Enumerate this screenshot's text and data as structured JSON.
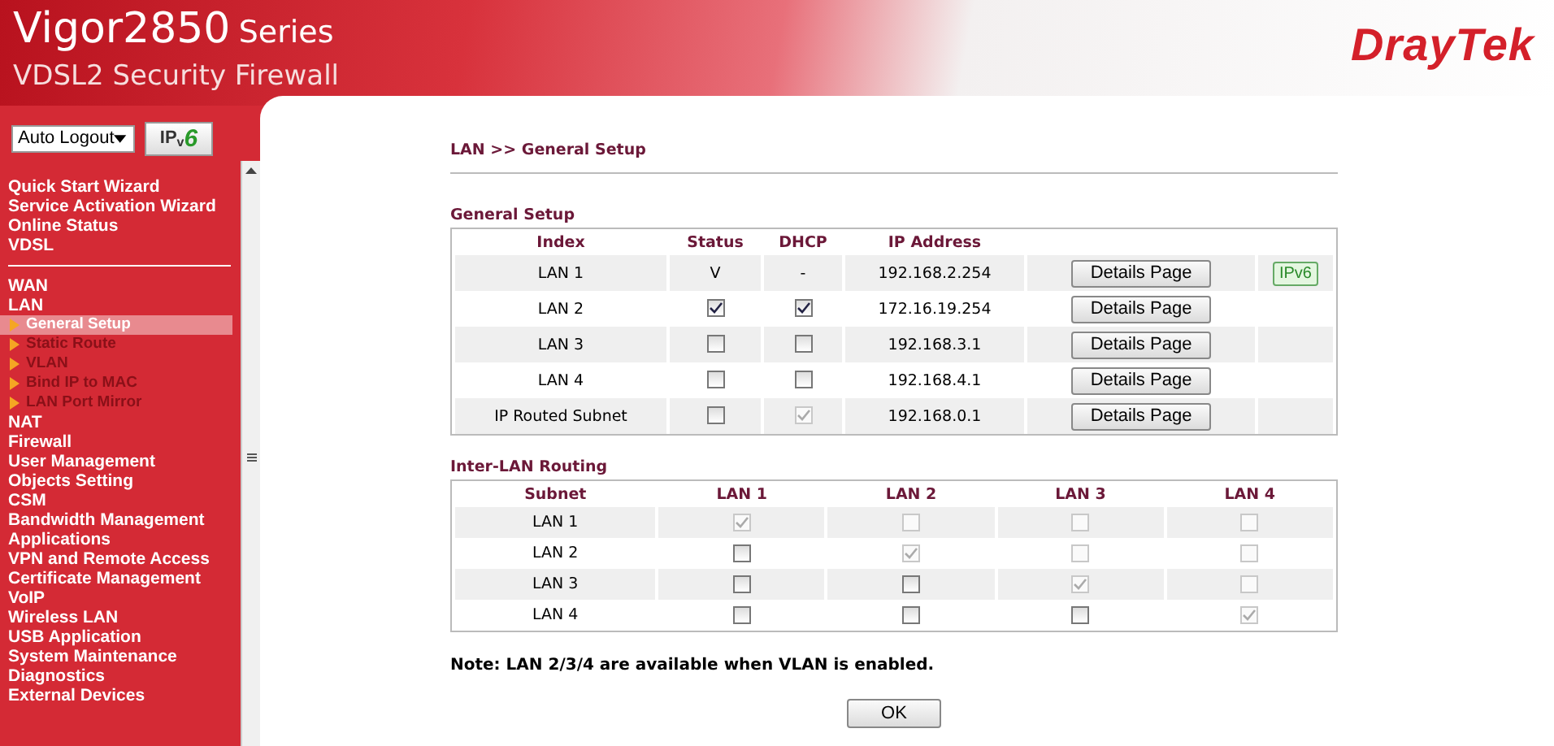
{
  "header": {
    "model": "Vigor2850",
    "series": "Series",
    "subtitle": "VDSL2 Security Firewall",
    "brand": "DrayTek"
  },
  "sidebar": {
    "logout_select": "Auto Logout",
    "ipv6_button": "IP",
    "ipv6_button_sub": "v",
    "ipv6_button_num": "6",
    "groups": [
      [
        {
          "label": "Quick Start Wizard",
          "sub": false,
          "selected": false
        },
        {
          "label": "Service Activation Wizard",
          "sub": false,
          "selected": false
        },
        {
          "label": "Online Status",
          "sub": false,
          "selected": false
        },
        {
          "label": "VDSL",
          "sub": false,
          "selected": false
        }
      ],
      [
        {
          "label": "WAN",
          "sub": false,
          "selected": false
        },
        {
          "label": "LAN",
          "sub": false,
          "selected": false
        },
        {
          "label": "General Setup",
          "sub": true,
          "selected": true
        },
        {
          "label": "Static Route",
          "sub": true,
          "selected": false
        },
        {
          "label": "VLAN",
          "sub": true,
          "selected": false
        },
        {
          "label": "Bind IP to MAC",
          "sub": true,
          "selected": false
        },
        {
          "label": "LAN Port Mirror",
          "sub": true,
          "selected": false
        },
        {
          "label": "NAT",
          "sub": false,
          "selected": false
        },
        {
          "label": "Firewall",
          "sub": false,
          "selected": false
        },
        {
          "label": "User Management",
          "sub": false,
          "selected": false
        },
        {
          "label": "Objects Setting",
          "sub": false,
          "selected": false
        },
        {
          "label": "CSM",
          "sub": false,
          "selected": false
        },
        {
          "label": "Bandwidth Management",
          "sub": false,
          "selected": false
        },
        {
          "label": "Applications",
          "sub": false,
          "selected": false
        },
        {
          "label": "VPN and Remote Access",
          "sub": false,
          "selected": false
        },
        {
          "label": "Certificate Management",
          "sub": false,
          "selected": false
        },
        {
          "label": "VoIP",
          "sub": false,
          "selected": false
        },
        {
          "label": "Wireless LAN",
          "sub": false,
          "selected": false
        },
        {
          "label": "USB Application",
          "sub": false,
          "selected": false
        },
        {
          "label": "System Maintenance",
          "sub": false,
          "selected": false
        },
        {
          "label": "Diagnostics",
          "sub": false,
          "selected": false
        },
        {
          "label": "External Devices",
          "sub": false,
          "selected": false
        }
      ]
    ]
  },
  "breadcrumb": "LAN >> General Setup",
  "general_setup": {
    "title": "General Setup",
    "columns": [
      "Index",
      "Status",
      "DHCP",
      "IP Address"
    ],
    "rows": [
      {
        "index": "LAN 1",
        "status": {
          "kind": "text",
          "text": "V"
        },
        "dhcp": {
          "kind": "text",
          "text": "-"
        },
        "ip": "192.168.2.254",
        "details": "Details Page",
        "ipv6": "IPv6"
      },
      {
        "index": "LAN 2",
        "status": {
          "kind": "checkbox",
          "checked": true,
          "disabled": false
        },
        "dhcp": {
          "kind": "checkbox",
          "checked": true,
          "disabled": false
        },
        "ip": "172.16.19.254",
        "details": "Details Page"
      },
      {
        "index": "LAN 3",
        "status": {
          "kind": "checkbox",
          "checked": false,
          "disabled": false
        },
        "dhcp": {
          "kind": "checkbox",
          "checked": false,
          "disabled": false
        },
        "ip": "192.168.3.1",
        "details": "Details Page"
      },
      {
        "index": "LAN 4",
        "status": {
          "kind": "checkbox",
          "checked": false,
          "disabled": false
        },
        "dhcp": {
          "kind": "checkbox",
          "checked": false,
          "disabled": false
        },
        "ip": "192.168.4.1",
        "details": "Details Page"
      },
      {
        "index": "IP Routed Subnet",
        "status": {
          "kind": "checkbox",
          "checked": false,
          "disabled": false
        },
        "dhcp": {
          "kind": "checkbox",
          "checked": true,
          "disabled": true
        },
        "ip": "192.168.0.1",
        "details": "Details Page"
      }
    ]
  },
  "inter_lan": {
    "title": "Inter-LAN Routing",
    "columns": [
      "Subnet",
      "LAN 1",
      "LAN 2",
      "LAN 3",
      "LAN 4"
    ],
    "rows": [
      {
        "subnet": "LAN 1",
        "cells": [
          {
            "checked": true,
            "disabled": true
          },
          {
            "checked": false,
            "disabled": true
          },
          {
            "checked": false,
            "disabled": true
          },
          {
            "checked": false,
            "disabled": true
          }
        ]
      },
      {
        "subnet": "LAN 2",
        "cells": [
          {
            "checked": false,
            "disabled": false
          },
          {
            "checked": true,
            "disabled": true
          },
          {
            "checked": false,
            "disabled": true
          },
          {
            "checked": false,
            "disabled": true
          }
        ]
      },
      {
        "subnet": "LAN 3",
        "cells": [
          {
            "checked": false,
            "disabled": false
          },
          {
            "checked": false,
            "disabled": false
          },
          {
            "checked": true,
            "disabled": true
          },
          {
            "checked": false,
            "disabled": true
          }
        ]
      },
      {
        "subnet": "LAN 4",
        "cells": [
          {
            "checked": false,
            "disabled": false
          },
          {
            "checked": false,
            "disabled": false
          },
          {
            "checked": false,
            "disabled": false
          },
          {
            "checked": true,
            "disabled": true
          }
        ]
      }
    ]
  },
  "note": "Note: LAN 2/3/4 are available when VLAN is enabled.",
  "ok_button": "OK"
}
